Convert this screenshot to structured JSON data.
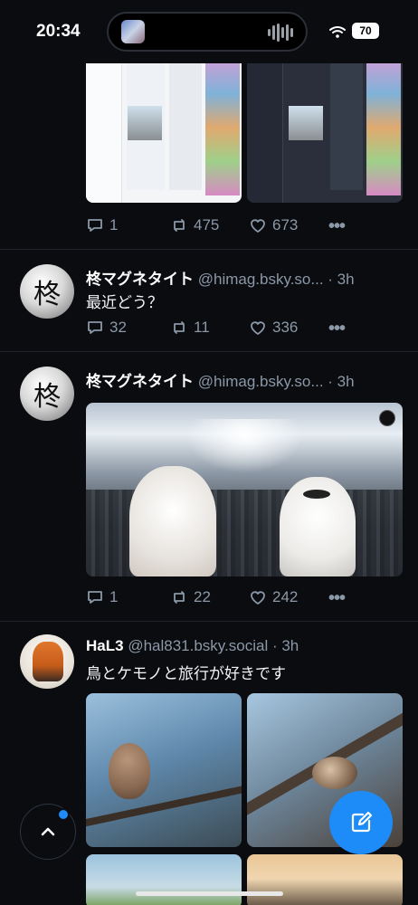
{
  "status_bar": {
    "time": "20:34",
    "battery": "70"
  },
  "posts": [
    {
      "stats": {
        "replies": "1",
        "reposts": "475",
        "likes": "673"
      },
      "more": "•••"
    },
    {
      "author": "柊マグネタイト",
      "handle": "@himag.bsky.so...",
      "time": "· 3h",
      "text": "最近どう？",
      "avatar_char": "柊",
      "stats": {
        "replies": "32",
        "reposts": "11",
        "likes": "336"
      },
      "more": "•••"
    },
    {
      "author": "柊マグネタイト",
      "handle": "@himag.bsky.so...",
      "time": "· 3h",
      "avatar_char": "柊",
      "stats": {
        "replies": "1",
        "reposts": "22",
        "likes": "242"
      },
      "more": "•••"
    },
    {
      "author": "HaL3",
      "handle": "@hal831.bsky.social",
      "time": "· 3h",
      "text": "鳥とケモノと旅行が好きです"
    }
  ],
  "colors": {
    "accent": "#1d8cf8",
    "background": "#0a0c10",
    "muted": "#8b98a7"
  },
  "icons": [
    "wifi-icon",
    "reply-icon",
    "repost-icon",
    "like-icon",
    "more-icon",
    "chevron-up-icon",
    "compose-icon",
    "tiktok-icon"
  ]
}
